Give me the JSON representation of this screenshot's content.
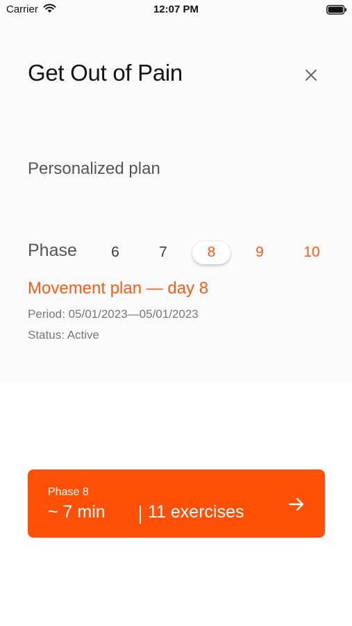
{
  "status_bar": {
    "carrier": "Carrier",
    "time": "12:07 PM"
  },
  "header": {
    "title": "Get Out of Pain",
    "close_icon": "close-icon"
  },
  "plan": {
    "subtitle": "Personalized plan",
    "phase_label": "Phase",
    "phases": [
      "6",
      "7",
      "8",
      "9",
      "10"
    ],
    "selected_phase": "8",
    "title": "Movement plan — day 8",
    "period": "Period: 05/01/2023—05/01/2023",
    "status": "Status: Active"
  },
  "card": {
    "phase": "Phase 8",
    "duration": "~ 7 min",
    "exercises": "11 exercises",
    "arrow_icon": "arrow-right-icon"
  },
  "colors": {
    "accent": "#ff5a14",
    "card_bg": "#ff5008",
    "muted_text": "#777777"
  }
}
